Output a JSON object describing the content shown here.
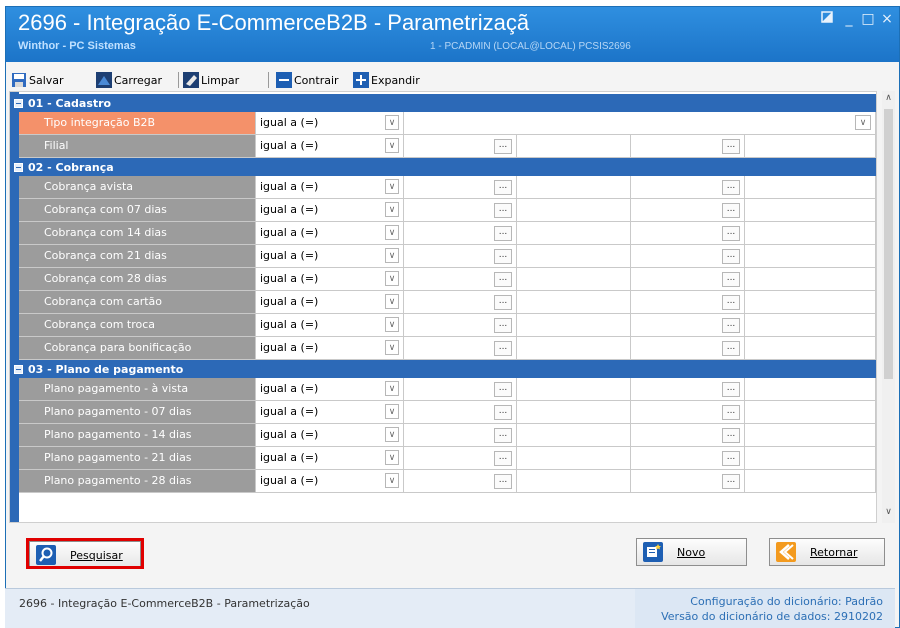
{
  "window": {
    "title": "2696 - Integração E-CommerceB2B - Parametrizaçã",
    "subtitle": "Winthor - PC Sistemas",
    "user_info": "1 - PCADMIN (LOCAL@LOCAL)  PCSIS2696",
    "controls": {
      "restore_icon": "restore-icon",
      "minimize": "_",
      "maximize": "□",
      "close": "×"
    }
  },
  "toolbar": {
    "save": "Salvar",
    "load": "Carregar",
    "clear": "Limpar",
    "collapse": "Contrair",
    "expand": "Expandir"
  },
  "grid": {
    "sections": [
      {
        "title": "01 - Cadastro",
        "rows": [
          {
            "label": "Tipo integração B2B",
            "operator": "igual a (=)",
            "selected": true,
            "single_value": true
          },
          {
            "label": "Filial",
            "operator": "igual a (=)"
          }
        ]
      },
      {
        "title": "02 - Cobrança",
        "rows": [
          {
            "label": "Cobrança  avista",
            "operator": "igual a (=)"
          },
          {
            "label": "Cobrança  com 07 dias",
            "operator": "igual a (=)"
          },
          {
            "label": "Cobrança  com 14 dias",
            "operator": "igual a (=)"
          },
          {
            "label": "Cobrança  com 21 dias",
            "operator": "igual a (=)"
          },
          {
            "label": "Cobrança  com 28 dias",
            "operator": "igual a (=)"
          },
          {
            "label": "Cobrança  com cartão",
            "operator": "igual a (=)"
          },
          {
            "label": "Cobrança  com troca",
            "operator": "igual a (=)"
          },
          {
            "label": "Cobrança para bonificação",
            "operator": "igual a (=)"
          }
        ]
      },
      {
        "title": "03 - Plano de pagamento",
        "rows": [
          {
            "label": "Plano pagamento - à vista",
            "operator": "igual a (=)"
          },
          {
            "label": "Plano pagamento - 07 dias",
            "operator": "igual a (=)"
          },
          {
            "label": "Plano pagamento - 14 dias",
            "operator": "igual a (=)"
          },
          {
            "label": "Plano pagamento - 21 dias",
            "operator": "igual a (=)"
          },
          {
            "label": "Plano pagamento - 28 dias",
            "operator": "igual a (=)"
          }
        ]
      }
    ],
    "ellipsis": "...",
    "dropdown_glyph": "∨"
  },
  "buttons": {
    "search": "Pesquisar",
    "new": "Novo",
    "back": "Retornar"
  },
  "status": {
    "left": "2696 - Integração E-CommerceB2B - Parametrização",
    "dict_config_label": "Configuração do dicionário:",
    "dict_config_value": "Padrão",
    "dict_version_label": "Versão do dicionário de dados:",
    "dict_version_value": "2910202"
  },
  "colors": {
    "title_bar": "#1c74c8",
    "section_header": "#2c69b7",
    "label_cell": "#9c9c9c",
    "selected_label": "#f4916a",
    "highlight_border": "#e00000"
  }
}
